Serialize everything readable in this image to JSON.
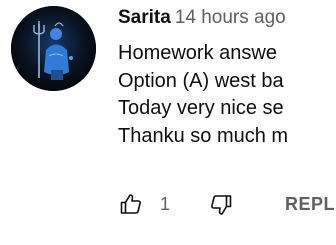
{
  "comment": {
    "author": "Sarita",
    "time": "14 hours ago",
    "lines": [
      "Homework answe",
      "Option (A) west ba",
      "Today very nice se",
      "Thanku so much m"
    ],
    "like_count": "1",
    "reply_label": "REPL"
  },
  "icons": {
    "like": "thumbs-up-icon",
    "dislike": "thumbs-down-icon"
  },
  "colors": {
    "primary_text": "#0f0f0f",
    "secondary_text": "#606060",
    "avatar_bg": "#06080d",
    "avatar_figure": "#2f7bd6"
  }
}
